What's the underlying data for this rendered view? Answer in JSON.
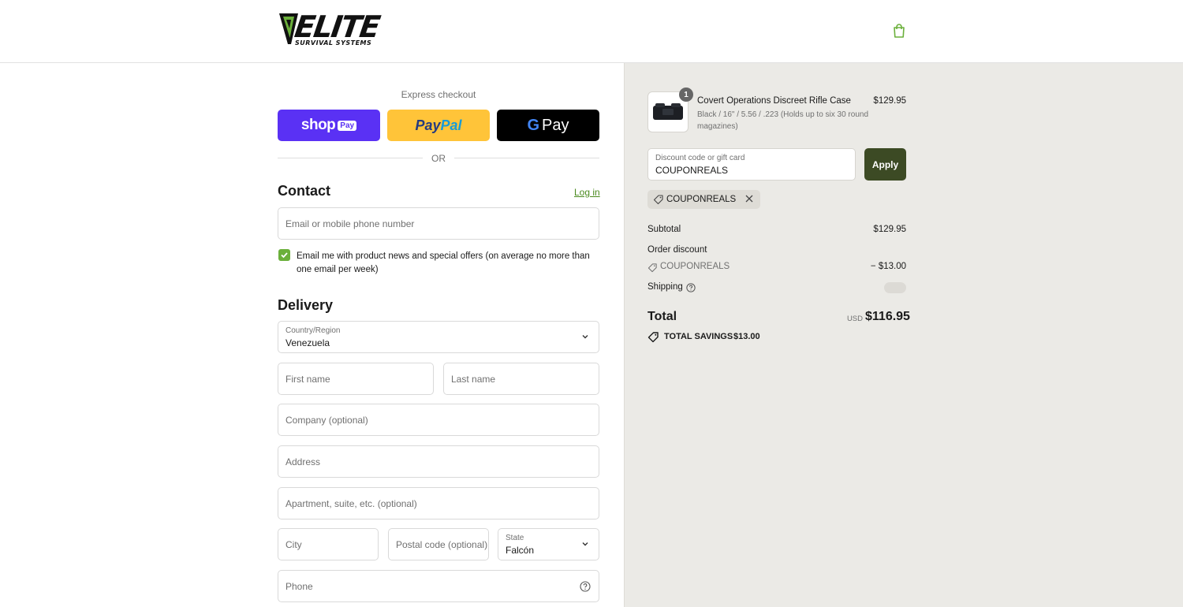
{
  "header": {
    "logo_text": "ELITE",
    "logo_subtext": "SURVIVAL SYSTEMS",
    "cart_icon": "shopping-bag-icon"
  },
  "express": {
    "label": "Express checkout",
    "shoppay_label": "shop",
    "shoppay_badge": "Pay",
    "paypal_label_1": "Pay",
    "paypal_label_2": "Pal",
    "gpay_g": "G",
    "gpay_label": "Pay",
    "or_text": "OR"
  },
  "contact": {
    "title": "Contact",
    "login_link": "Log in",
    "email_placeholder": "Email or mobile phone number",
    "marketing_optin_label": "Email me with product news and special offers (on average no more than one email per week)",
    "marketing_optin_checked": true
  },
  "delivery": {
    "title": "Delivery",
    "country_label": "Country/Region",
    "country_value": "Venezuela",
    "first_name_placeholder": "First name",
    "last_name_placeholder": "Last name",
    "company_placeholder": "Company (optional)",
    "address_placeholder": "Address",
    "apartment_placeholder": "Apartment, suite, etc. (optional)",
    "city_placeholder": "City",
    "postal_placeholder": "Postal code (optional)",
    "state_label": "State",
    "state_value": "Falcón",
    "phone_placeholder": "Phone"
  },
  "summary": {
    "product": {
      "quantity": "1",
      "name": "Covert Operations Discreet Rifle Case",
      "variant": "Black / 16\" / 5.56 / .223 (Holds up to six 30 round magazines)",
      "price": "$129.95"
    },
    "discount_label": "Discount code or gift card",
    "discount_value": "COUPONREALS",
    "apply_label": "Apply",
    "applied_tag": "COUPONREALS",
    "subtotal_label": "Subtotal",
    "subtotal_value": "$129.95",
    "order_discount_label": "Order discount",
    "discount_code": "COUPONREALS",
    "discount_amount": "− $13.00",
    "shipping_label": "Shipping",
    "total_label": "Total",
    "currency": "USD",
    "total_value": "$116.95",
    "savings_label": "TOTAL SAVINGS",
    "savings_value": "$13.00"
  },
  "colors": {
    "accent_green": "#6bb03b",
    "apply_button": "#3c4a24",
    "shoppay": "#5a31f4",
    "paypal": "#ffc439",
    "summary_bg": "#ebeae6"
  }
}
